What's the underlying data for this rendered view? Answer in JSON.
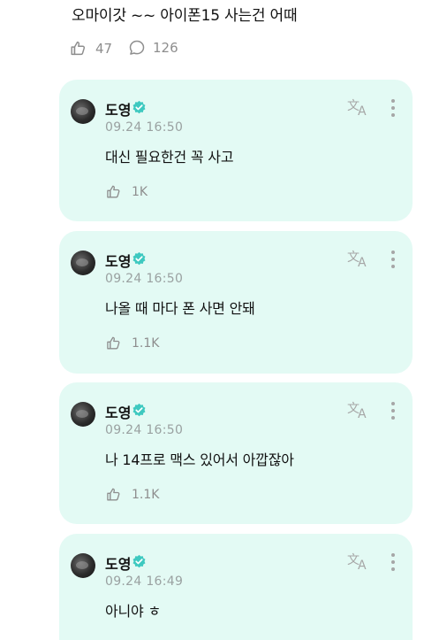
{
  "post": {
    "text": "오마이갓 ~~ 아이폰15 사는건 어때",
    "likes": "47",
    "comments": "126"
  },
  "replies": [
    {
      "author": "도영",
      "time": "09.24 16:50",
      "text": "대신 필요한건 꼭 사고",
      "likes": "1K"
    },
    {
      "author": "도영",
      "time": "09.24 16:50",
      "text": "나올 때 마다 폰 사면 안돼",
      "likes": "1.1K"
    },
    {
      "author": "도영",
      "time": "09.24 16:50",
      "text": "나 14프로 맥스 있어서 아깝잖아",
      "likes": "1.1K"
    },
    {
      "author": "도영",
      "time": "09.24 16:49",
      "text": "아니야 ㅎ",
      "likes": ""
    }
  ],
  "icons": {
    "like": "like-icon",
    "comment": "comment-bubble-icon",
    "verified": "verified-badge-icon",
    "translate": "translate-icon",
    "more": "more-vertical-icon"
  },
  "colors": {
    "card_bg": "#e3faf4",
    "verified": "#3ec9c0",
    "muted": "#8e8e8e"
  }
}
